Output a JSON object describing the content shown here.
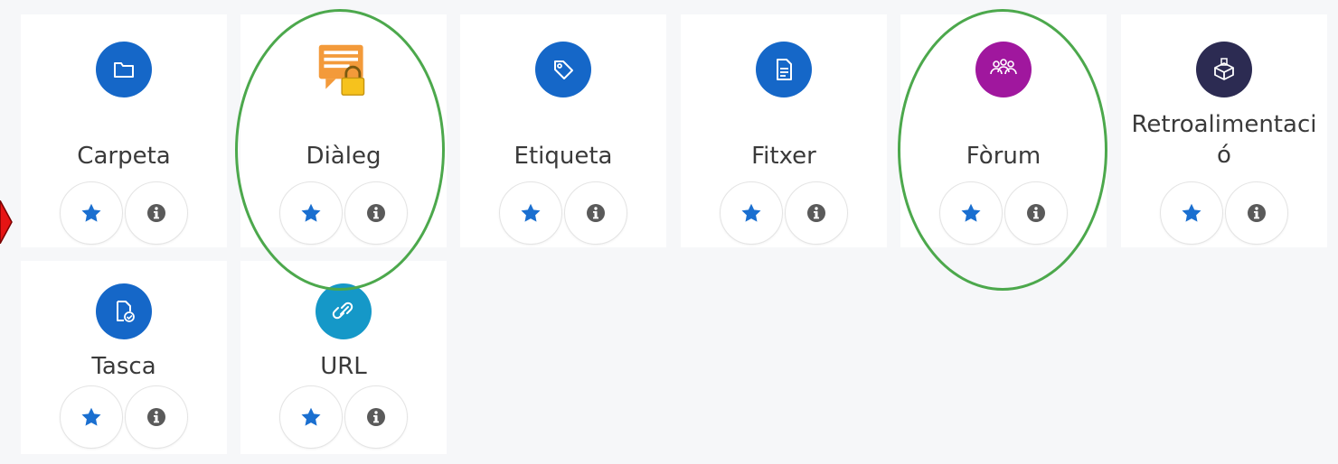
{
  "activities": [
    {
      "label": "Carpeta",
      "icon": "folder-icon",
      "color": "#1567c8"
    },
    {
      "label": "Diàleg",
      "icon": "dialog-lock-icon",
      "color": "#f5a43a"
    },
    {
      "label": "Etiqueta",
      "icon": "tag-icon",
      "color": "#1567c8"
    },
    {
      "label": "Fitxer",
      "icon": "file-icon",
      "color": "#1567c8"
    },
    {
      "label": "Fòrum",
      "icon": "forum-people-icon",
      "color": "#a0179e"
    },
    {
      "label": "Retroalimentaci\nó",
      "icon": "feedback-box-icon",
      "color": "#2c2b52"
    },
    {
      "label": "Tasca",
      "icon": "assignment-icon",
      "color": "#1567c8"
    },
    {
      "label": "URL",
      "icon": "link-icon",
      "color": "#1598c8"
    }
  ],
  "buttons": {
    "star_icon": "star-icon",
    "info_icon": "info-icon",
    "star_color": "#1a6fd0",
    "info_color": "#5a5a5a"
  },
  "annotations": {
    "highlight_color": "#4ca84c",
    "pointer_color": "#e01010"
  }
}
